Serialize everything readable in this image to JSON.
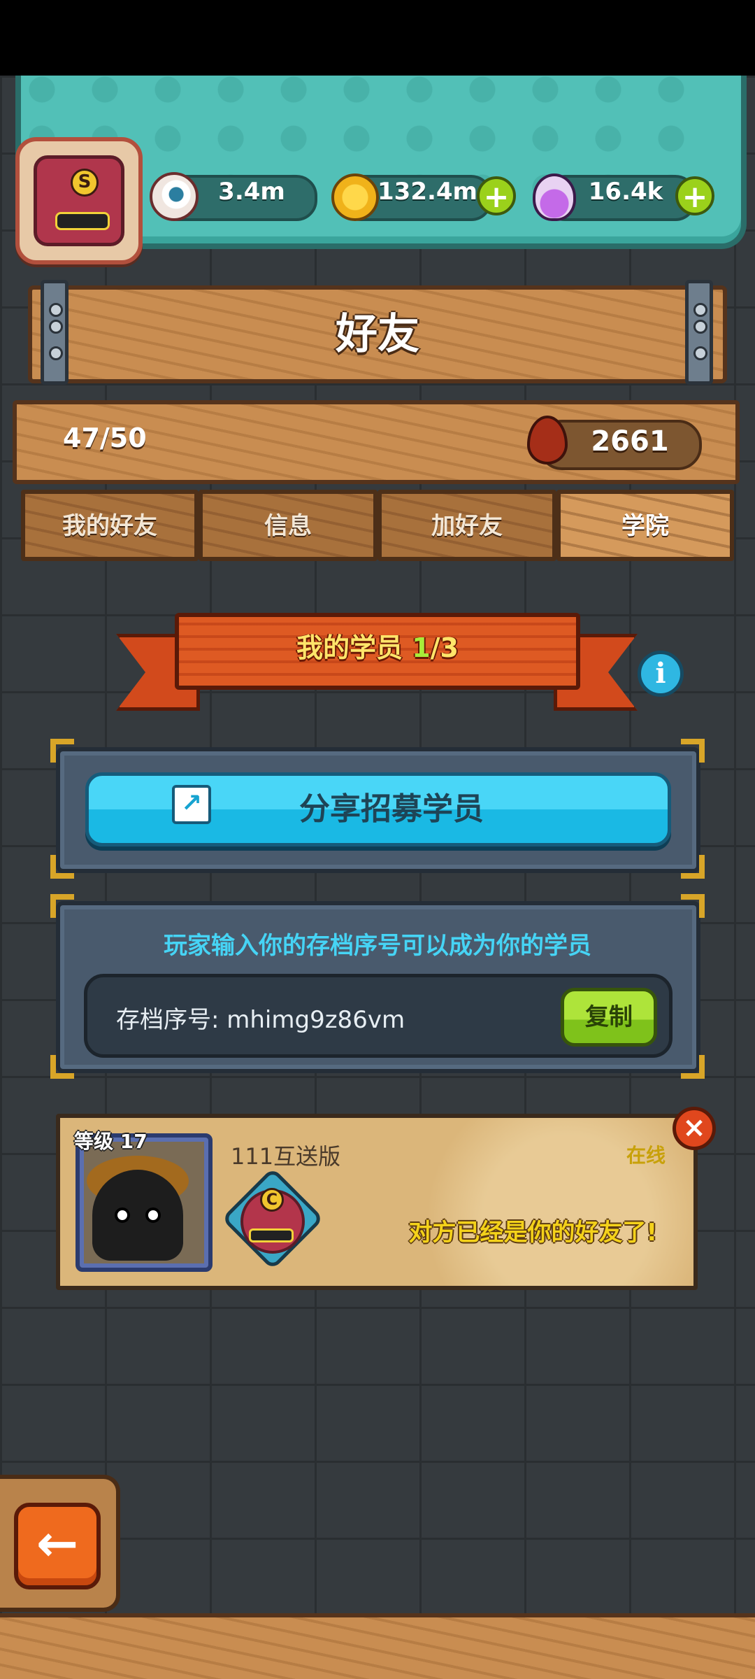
{
  "resources": {
    "eye_value": "3.4m",
    "coin_value": "132.4m",
    "potion_value": "16.4k"
  },
  "icons": {
    "eye": "eyeball-icon",
    "coin": "gold-coin-icon",
    "potion": "purple-potion-icon",
    "plus": "plus-icon",
    "blood": "blood-drop-icon",
    "info": "info-icon",
    "share": "share-icon",
    "close": "close-icon",
    "back": "back-arrow-icon"
  },
  "avatar": {
    "rank_letter": "S"
  },
  "header": {
    "title": "好友"
  },
  "stats": {
    "friend_count": "47/50",
    "blood_value": "2661"
  },
  "tabs": [
    {
      "label": "我的好友",
      "active": false
    },
    {
      "label": "信息",
      "active": false
    },
    {
      "label": "加好友",
      "active": false
    },
    {
      "label": "学院",
      "active": true
    }
  ],
  "academy": {
    "banner_prefix": "我的学员 ",
    "banner_count": "1",
    "banner_total": "/3",
    "share_label": "分享招募学员",
    "hint": "玩家输入你的存档序号可以成为你的学员",
    "code_label": "存档序号: mhimg9z86vm",
    "copy_label": "复制"
  },
  "student": {
    "level_label": "等级 17",
    "name": "111互送版",
    "status": "在线",
    "badge_letter": "C",
    "message": "对方已经是你的好友了!"
  },
  "colors": {
    "teal": "#52c0b7",
    "wood": "#c98d51",
    "ribbon": "#de5a23",
    "share_button": "#1ab9e4",
    "copy_button": "#7fc21b",
    "online": "#c8a10a"
  }
}
